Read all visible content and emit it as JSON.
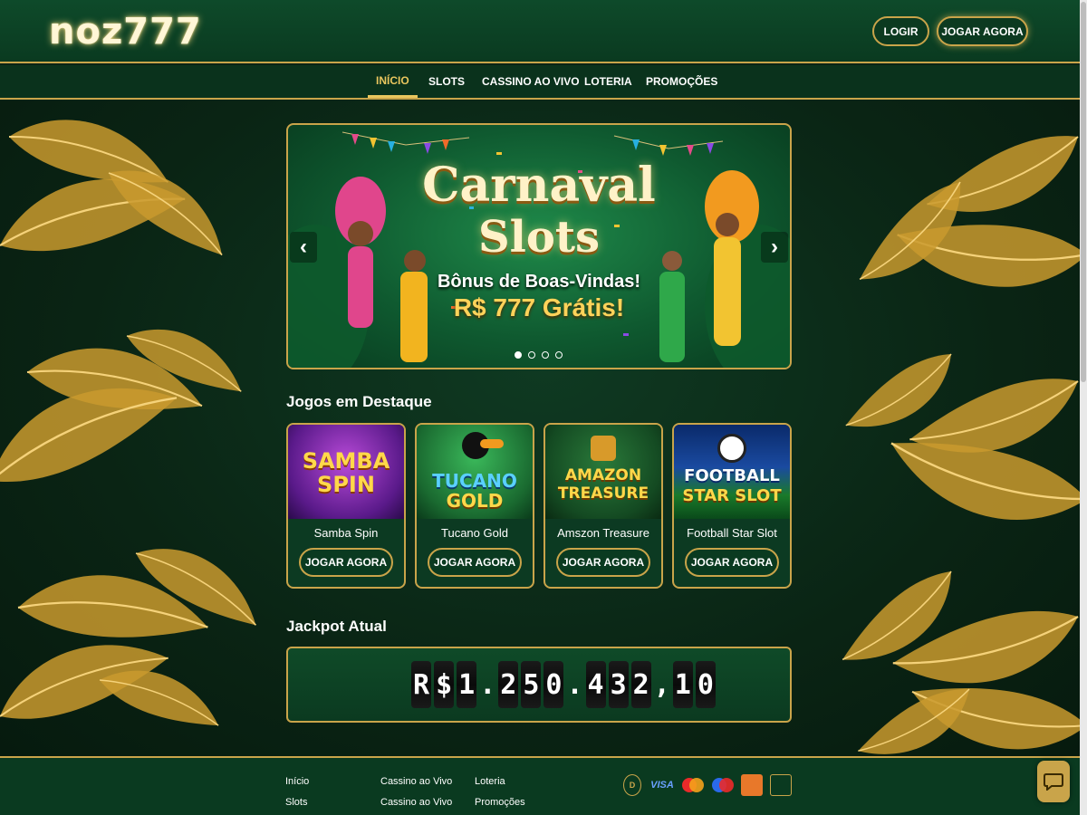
{
  "header": {
    "logo": "noz777",
    "login_label": "LOGIR",
    "play_label": "JOGAR AGORA"
  },
  "nav": {
    "items": [
      {
        "label": "INÍCIO",
        "active": true
      },
      {
        "label": "SLOTS",
        "active": false
      },
      {
        "label": "CASSINO AO VIVO",
        "active": false
      },
      {
        "label": "LOTERIA",
        "active": false
      },
      {
        "label": "PROMOÇÕES",
        "active": false
      }
    ]
  },
  "banner": {
    "title_line1": "Carnaval",
    "title_line2": "Slots",
    "subtitle": "Bônus de Boas-Vindas!",
    "offer": "R$ 777 Grátis!",
    "prev_icon": "chevron-left-icon",
    "next_icon": "chevron-right-icon",
    "slides": 4,
    "active_slide": 1
  },
  "featured": {
    "title": "Jogos em Destaque",
    "games": [
      {
        "image_text": [
          "SAMBA",
          "SPIN"
        ],
        "name": "Samba Spin",
        "button": "JOGAR AGORA"
      },
      {
        "image_text": [
          "TUCANO",
          "GOLD"
        ],
        "name": "Tucano Gold",
        "button": "JOGAR AGORA"
      },
      {
        "image_text": [
          "AMAZON",
          "TREASURE"
        ],
        "name": "Amszon Treasure",
        "button": "JOGAR AGORA"
      },
      {
        "image_text": [
          "FOOTBALL",
          "STAR SLOT"
        ],
        "name": "Football Star Slot",
        "button": "JOGAR AGORA"
      }
    ]
  },
  "jackpot": {
    "title": "Jackpot Atual",
    "value": "R$1.250.432,10"
  },
  "footer": {
    "col1": [
      "Início",
      "Slots"
    ],
    "col2": [
      "Cassino ao Vivo",
      "Cassino ao Vivo"
    ],
    "col3": [
      "Loteria",
      "Promoções"
    ],
    "payments": [
      "VISA"
    ]
  },
  "colors": {
    "gold": "#c9a44a",
    "green_dark": "#0a3a20",
    "accent_yellow": "#e9c65e"
  },
  "chat_icon": "chat-bubble-icon"
}
